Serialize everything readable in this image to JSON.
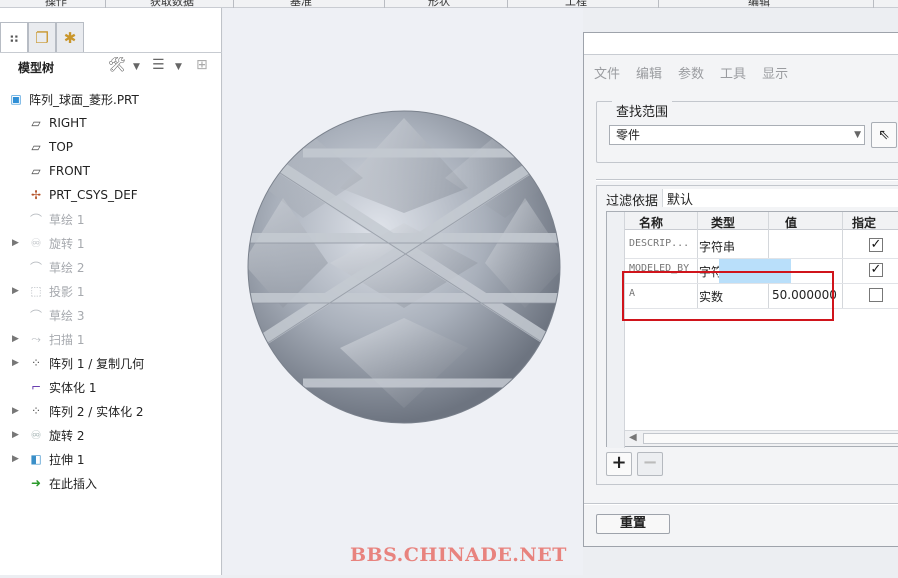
{
  "topbar": {
    "tabs": [
      "操作",
      "获取数据",
      "基准",
      "形状",
      "工程",
      "编辑"
    ]
  },
  "left_panel": {
    "tabs": [
      {
        "icon": "model-tree-icon"
      },
      {
        "icon": "layers-icon"
      },
      {
        "icon": "favorites-icon"
      }
    ],
    "title": "模型树",
    "tree": [
      {
        "label": "阵列_球面_菱形.PRT",
        "icon": "part-icon",
        "dim": false,
        "expander": false,
        "indent": false
      },
      {
        "label": "RIGHT",
        "icon": "datum-plane-icon",
        "dim": false,
        "expander": false,
        "indent": true
      },
      {
        "label": "TOP",
        "icon": "datum-plane-icon",
        "dim": false,
        "expander": false,
        "indent": true
      },
      {
        "label": "FRONT",
        "icon": "datum-plane-icon",
        "dim": false,
        "expander": false,
        "indent": true
      },
      {
        "label": "PRT_CSYS_DEF",
        "icon": "csys-icon",
        "dim": false,
        "expander": false,
        "indent": true
      },
      {
        "label": "草绘 1",
        "icon": "sketch-icon",
        "dim": true,
        "expander": false,
        "indent": true
      },
      {
        "label": "旋转 1",
        "icon": "revolve-icon",
        "dim": true,
        "expander": true,
        "indent": true
      },
      {
        "label": "草绘 2",
        "icon": "sketch-icon",
        "dim": true,
        "expander": false,
        "indent": true
      },
      {
        "label": "投影 1",
        "icon": "projection-icon",
        "dim": true,
        "expander": true,
        "indent": true
      },
      {
        "label": "草绘 3",
        "icon": "sketch-icon",
        "dim": true,
        "expander": false,
        "indent": true
      },
      {
        "label": "扫描 1",
        "icon": "sweep-icon",
        "dim": true,
        "expander": true,
        "indent": true
      },
      {
        "label": "阵列 1 / 复制几何",
        "icon": "pattern-icon",
        "dim": false,
        "expander": true,
        "indent": true
      },
      {
        "label": "实体化 1",
        "icon": "solidify-icon",
        "dim": false,
        "expander": false,
        "indent": true
      },
      {
        "label": "阵列 2 / 实体化 2",
        "icon": "pattern-icon",
        "dim": false,
        "expander": true,
        "indent": true
      },
      {
        "label": "旋转 2",
        "icon": "revolve-icon",
        "dim": false,
        "expander": true,
        "indent": true
      },
      {
        "label": "拉伸 1",
        "icon": "extrude-icon",
        "dim": false,
        "expander": true,
        "indent": true
      },
      {
        "label": "在此插入",
        "icon": "insert-here-icon",
        "dim": false,
        "expander": false,
        "indent": true
      }
    ]
  },
  "dialog": {
    "menu": [
      "文件",
      "编辑",
      "参数",
      "工具",
      "显示"
    ],
    "lookup_title": "查找范围",
    "lookup_value": "零件",
    "filter_label": "过滤依据",
    "filter_value": "默认",
    "columns": [
      "名称",
      "类型",
      "值",
      "指定"
    ],
    "rows": [
      {
        "name": "DESCRIP...",
        "type": "字符串",
        "value": "",
        "designated": true
      },
      {
        "name": "MODELED_BY",
        "type": "字符串",
        "value": "",
        "designated": true
      },
      {
        "name": "A",
        "type": "实数",
        "value": "50.000000",
        "designated": false
      }
    ],
    "add_label": "+",
    "remove_label": "−",
    "reset_label": "重置"
  },
  "watermark": "BBS.CHINADE.NET",
  "colors": {
    "highlight": "#b9dffa",
    "redbox": "#d0141b",
    "sphere": "#a9b0bb",
    "watermark": "#e8837e"
  }
}
